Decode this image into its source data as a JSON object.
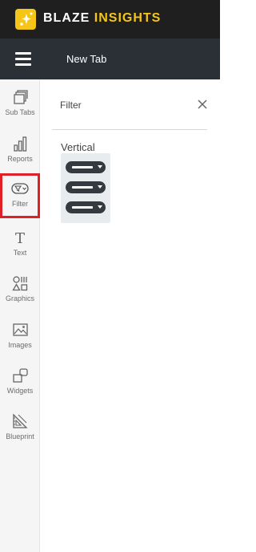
{
  "app": {
    "brand_white": "BLAZE",
    "brand_yellow": "INSIGHTS",
    "logo_icon": "sparkle-icon",
    "brand_color": "#f5c518"
  },
  "navbar": {
    "menu_icon": "hamburger-icon",
    "tab_title": "New Tab"
  },
  "sidebar": {
    "items": [
      {
        "label": "Sub Tabs",
        "icon": "sub-tabs-icon",
        "active": false
      },
      {
        "label": "Reports",
        "icon": "bar-chart-icon",
        "active": false
      },
      {
        "label": "Filter",
        "icon": "filter-icon",
        "active": true
      },
      {
        "label": "Text",
        "icon": "text-icon",
        "active": false
      },
      {
        "label": "Graphics",
        "icon": "shapes-icon",
        "active": false
      },
      {
        "label": "Images",
        "icon": "image-icon",
        "active": false
      },
      {
        "label": "Widgets",
        "icon": "widgets-icon",
        "active": false
      },
      {
        "label": "Blueprint",
        "icon": "blueprint-icon",
        "active": false
      }
    ],
    "active_color": "#e02027"
  },
  "panel": {
    "title": "Filter",
    "close_icon": "close-icon",
    "section_label": "Vertical",
    "widget_icon": "vertical-filter-dropdowns-icon"
  }
}
